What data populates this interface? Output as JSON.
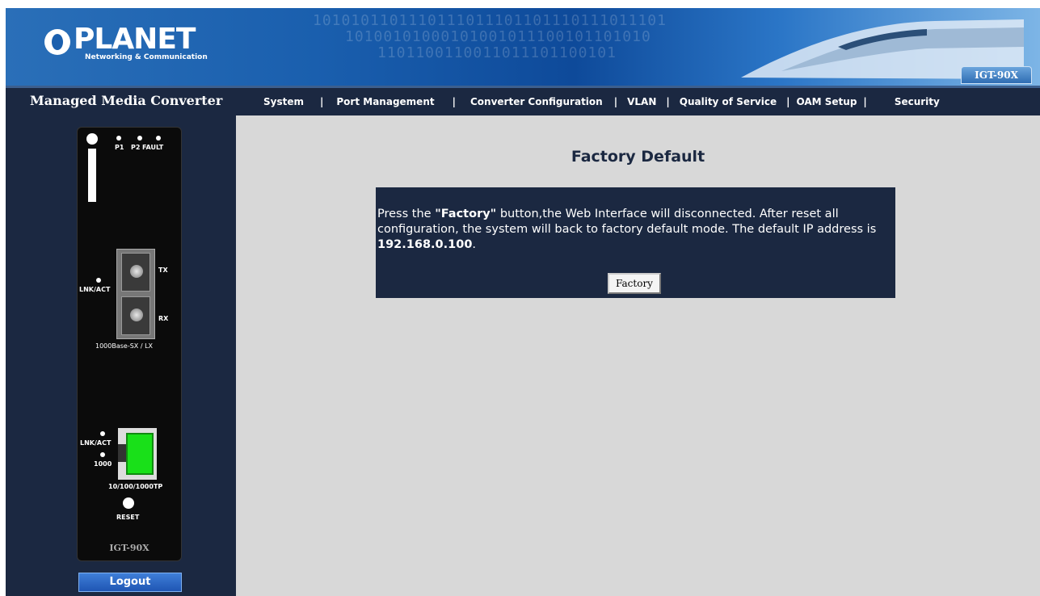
{
  "banner": {
    "brand": "PLANET",
    "tagline": "Networking & Communication",
    "model_tag": "IGT-90X",
    "binary_rows": [
      "1010101101110111011101101110111011101",
      "10100101000101001011100101101010",
      "1101100110011011101100101"
    ]
  },
  "nav": {
    "title": "Managed Media Converter",
    "items": [
      "System",
      "Port Management",
      "Converter Configuration",
      "VLAN",
      "Quality of Service",
      "OAM Setup",
      "Security"
    ],
    "separator": "|"
  },
  "device": {
    "led_labels": [
      "P1",
      "P2",
      "FAULT"
    ],
    "brand": "PLANET",
    "fiber_led_label": "LNK/ACT",
    "tx_label": "TX",
    "rx_label": "RX",
    "fiber_caption": "1000Base-SX / LX",
    "copper_led1_label": "LNK/ACT",
    "copper_led2_label": "1000",
    "copper_caption": "10/100/1000TP",
    "reset_label": "RESET",
    "model": "IGT-90X"
  },
  "logout_label": "Logout",
  "page": {
    "title": "Factory Default",
    "msg_prefix": "Press the ",
    "msg_bold": "\"Factory\"",
    "msg_middle": " button,the Web Interface will disconnected. After reset all configuration, the system will back to factory default mode. The default IP address is ",
    "ip": "192.168.0.100",
    "msg_suffix": ".",
    "button_label": "Factory"
  },
  "colors": {
    "nav_bg": "#1b2841",
    "content_bg": "#d8d8d8",
    "title_color": "#1b2841",
    "rj45_green": "#19e019"
  }
}
